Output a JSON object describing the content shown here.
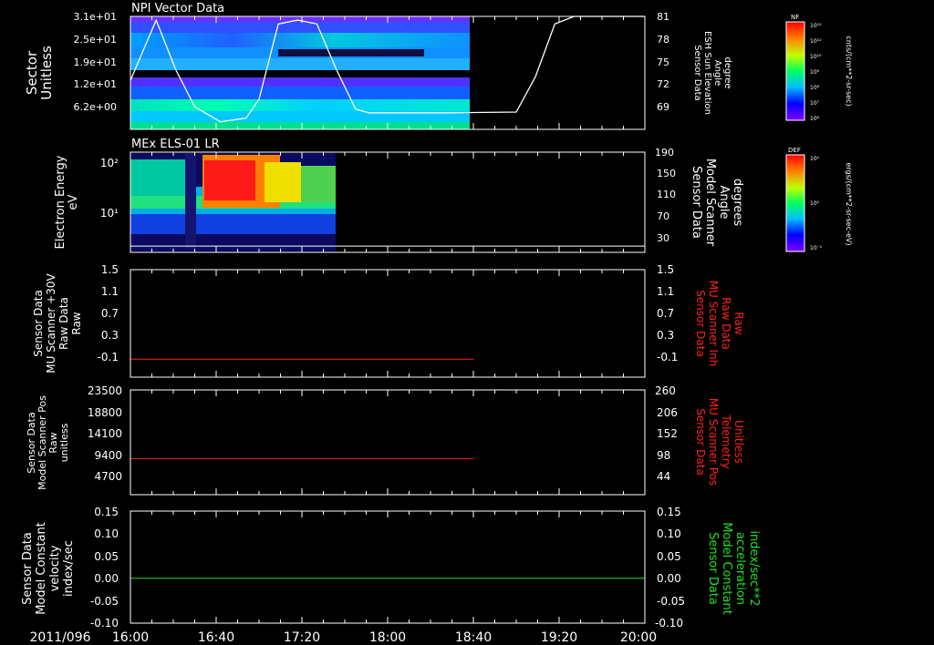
{
  "date_label": "2011/096",
  "x_ticks": [
    "16:00",
    "16:40",
    "17:20",
    "18:00",
    "18:40",
    "19:20",
    "20:00"
  ],
  "colorbars": {
    "nf": {
      "title": "NF",
      "unit": "cnts/(cm**2-sr-sec)",
      "labels": [
        "10¹²",
        "10¹¹",
        "10¹⁰",
        "10⁹",
        "10⁸",
        "10⁷",
        "10⁶"
      ]
    },
    "def": {
      "title": "DEF",
      "unit": "ergs/(cm**2-sr-sec-eV)",
      "labels": [
        "10¹",
        "10⁰",
        "10⁻¹"
      ]
    }
  },
  "colors": {
    "red_trace": "#ff2020",
    "green_trace": "#20e020",
    "white_trace": "#ffffff",
    "axis": "#ffffff"
  },
  "chart_data": [
    {
      "type": "heatmap",
      "title": "NPI Vector Data",
      "ylabel_lines": [
        "Sector",
        "Unitless"
      ],
      "y_ticks": [
        "3.1e+01",
        "2.5e+01",
        "1.9e+01",
        "1.2e+01",
        "6.2e+00"
      ],
      "y2label_lines": [
        "Sensor Data",
        "ESH Sun Elevation",
        "Angle",
        "degree"
      ],
      "y2_ticks": [
        "81",
        "78",
        "75",
        "72",
        "69"
      ],
      "data_time_range": [
        "16:00",
        "18:40"
      ],
      "overlay": {
        "series": "ESH Sun Elevation Angle",
        "color": "#ffffff",
        "x_hours": [
          16.0,
          16.2,
          16.35,
          16.5,
          16.7,
          16.9,
          17.0,
          17.15,
          17.3,
          17.45,
          17.6,
          17.75,
          17.85,
          18.0,
          18.5,
          19.0,
          19.15,
          19.3,
          19.45,
          20.0
        ],
        "y_degrees": [
          72.5,
          80.5,
          74.0,
          69.0,
          67.0,
          67.5,
          70.0,
          80.0,
          80.5,
          80.0,
          74.0,
          68.7,
          68.2,
          68.2,
          68.2,
          68.3,
          73.0,
          80.0,
          81.0,
          81.0
        ]
      }
    },
    {
      "type": "heatmap",
      "title": "MEx ELS-01 LR",
      "ylabel_lines": [
        "Electron Energy",
        "eV"
      ],
      "y_ticks": [
        "10²",
        "10¹"
      ],
      "y2label_lines": [
        "Sensor Data",
        "Model Scanner",
        "Angle",
        "degrees"
      ],
      "y2_ticks": [
        "190",
        "150",
        "110",
        "70",
        "30"
      ],
      "data_time_range": [
        "16:00",
        "17:32"
      ],
      "overlay": {
        "series": "Model Scanner Angle",
        "color": "#ffffff",
        "x_hours": [
          16.0,
          20.0
        ],
        "y_degrees": [
          12,
          12
        ]
      }
    },
    {
      "type": "line",
      "ylabel_lines": [
        "Sensor Data",
        "MU Scanner +30V",
        "Raw Data",
        "Raw"
      ],
      "y_ticks": [
        "1.5",
        "1.1",
        "0.7",
        "0.3",
        "-0.1"
      ],
      "y2label_lines": [
        "Sensor Data",
        "MU Scanner Inh",
        "Raw Data",
        "Raw"
      ],
      "y2_ticks": [
        "1.5",
        "1.1",
        "0.7",
        "0.3",
        "-0.1"
      ],
      "ylim": [
        -0.3,
        1.5
      ],
      "series": [
        {
          "color": "#ff2020",
          "x_hours": [
            16.0,
            18.67
          ],
          "values": [
            0.0,
            0.0
          ]
        }
      ]
    },
    {
      "type": "line",
      "ylabel_lines": [
        "Sensor Data",
        "Model Scanner Pos",
        "Raw",
        "unitless"
      ],
      "y_ticks": [
        "23500",
        "18800",
        "14100",
        "9400",
        "4700"
      ],
      "y2label_lines": [
        "Sensor Data",
        "MU Scanner Pos",
        "Telemetry",
        "Unitless"
      ],
      "y2_ticks": [
        "260",
        "206",
        "152",
        "98",
        "44"
      ],
      "ylim": [
        0,
        23500
      ],
      "series": [
        {
          "color": "#ff2020",
          "x_hours": [
            16.0,
            18.67
          ],
          "values": [
            8100,
            8100
          ]
        }
      ]
    },
    {
      "type": "line",
      "ylabel_lines": [
        "Sensor Data",
        "Model Constant",
        "velocity",
        "index/sec"
      ],
      "y_ticks": [
        "0.15",
        "0.10",
        "0.05",
        "0.00",
        "-0.05",
        "-0.10"
      ],
      "y2label_lines": [
        "Sensor Data",
        "Model Constant",
        "acceleration",
        "index/sec**2"
      ],
      "y2_ticks": [
        "0.15",
        "0.10",
        "0.05",
        "0.00",
        "-0.05",
        "-0.10"
      ],
      "ylim": [
        -0.1,
        0.15
      ],
      "series": [
        {
          "color": "#20e020",
          "x_hours": [
            16.0,
            20.0
          ],
          "values": [
            0.0,
            0.0
          ]
        }
      ]
    }
  ]
}
